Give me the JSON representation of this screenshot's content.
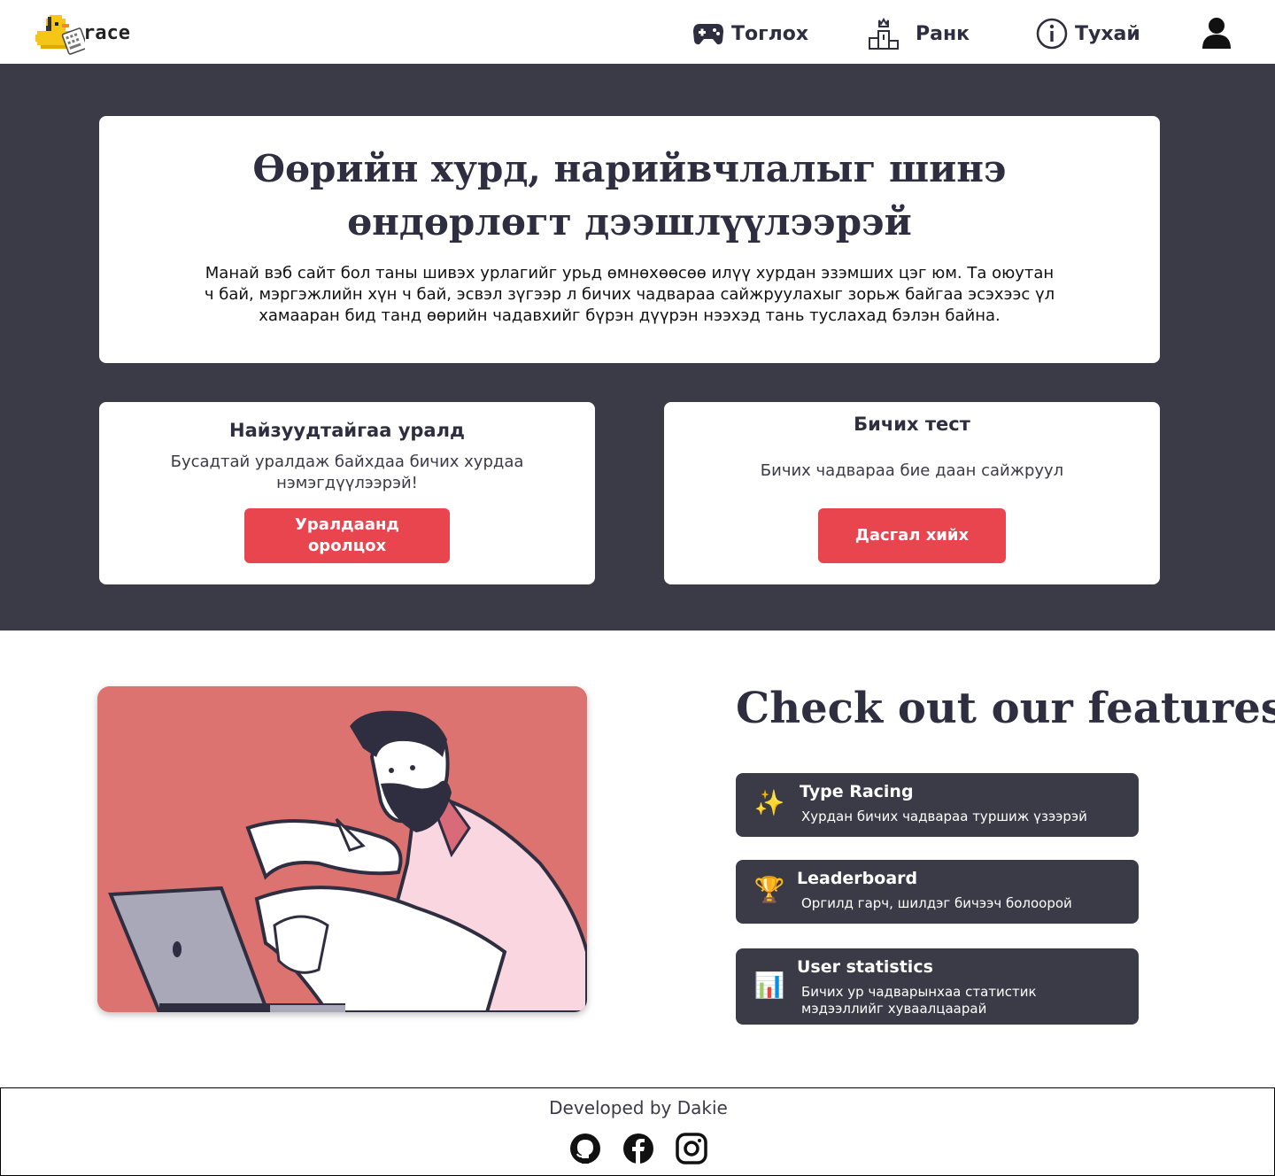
{
  "navbar": {
    "logo_text": "race",
    "items": [
      {
        "label": "Тоглох",
        "icon": "gamepad-icon"
      },
      {
        "label": "Ранк",
        "icon": "podium-icon"
      },
      {
        "label": "Тухай",
        "icon": "info-icon"
      }
    ],
    "profile_icon": "user-icon"
  },
  "hero": {
    "title": "Өөрийн хурд, нарийвчлалыг шинэ өндөрлөгт дээшлүүлээрэй",
    "text": "Манай вэб сайт бол таны шивэх урлагийг урьд өмнөхөөсөө илүү хурдан эзэмших цэг юм. Та оюутан ч бай, мэргэжлийн хүн ч бай, эсвэл зүгээр л бичих чадвараа сайжруулахыг зорьж байгаа эсэхээс үл хамааран бид танд өөрийн чадавхийг бүрэн дүүрэн нээхэд тань туслахад бэлэн байна."
  },
  "cards": {
    "race": {
      "title": "Найзуудтайгаа уралд",
      "text": "Бусадтай уралдаж байхдаа бичих хурдаа нэмэгдүүлээрэй!",
      "button": "Уралдаанд оролцох"
    },
    "test": {
      "title": "Бичих тест",
      "text": "Бичих чадвараа бие даан сайжруул",
      "button": "Дасгал хийх"
    }
  },
  "features": {
    "title": "Check out our features",
    "items": [
      {
        "title": "Type Racing",
        "desc": "Хурдан бичих чадвараа туршиж үзээрэй",
        "icon": "sparkles-icon",
        "glyph": "✨"
      },
      {
        "title": "Leaderboard",
        "desc": "Оргилд гарч, шилдэг бичээч болоорой",
        "icon": "trophy-icon",
        "glyph": "🏆"
      },
      {
        "title": "User statistics",
        "desc": "Бичих ур чадварынхаа статистик мэдээллийг хуваалцаарай",
        "icon": "bar-chart-icon",
        "glyph": "📊"
      }
    ]
  },
  "footer": {
    "text": "Developed by Dakie",
    "social": [
      "github-icon",
      "facebook-icon",
      "instagram-icon"
    ]
  },
  "colors": {
    "dark": "#3b3a47",
    "accent": "#e9454f",
    "illustration_bg": "#dc7370"
  }
}
